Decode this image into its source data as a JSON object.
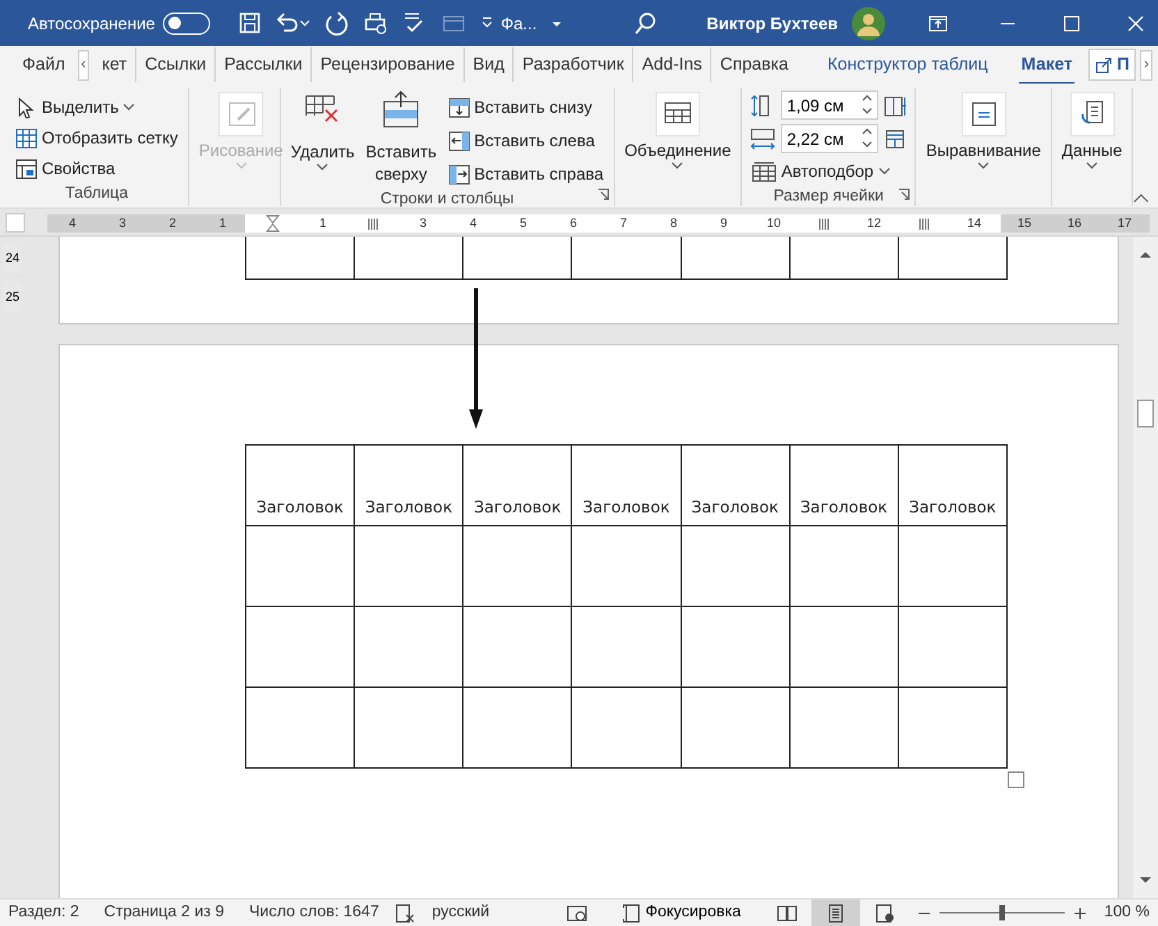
{
  "title_bar": {
    "autosave_label": "Автосохранение",
    "autosave_on": false,
    "file_name": "Фа...",
    "user_name": "Виктор Бухтеев"
  },
  "tabs": [
    {
      "label": "Файл",
      "selected": false,
      "kind": "tab"
    },
    {
      "label": "‹",
      "selected": false,
      "kind": "scroll"
    },
    {
      "label": "кет",
      "selected": false,
      "kind": "tab"
    },
    {
      "label": "Ссылки",
      "selected": false,
      "kind": "tab"
    },
    {
      "label": "Рассылки",
      "selected": false,
      "kind": "tab"
    },
    {
      "label": "Рецензирование",
      "selected": false,
      "kind": "tab"
    },
    {
      "label": "Вид",
      "selected": false,
      "kind": "tab"
    },
    {
      "label": "Разработчик",
      "selected": false,
      "kind": "tab"
    },
    {
      "label": "Add-Ins",
      "selected": false,
      "kind": "tab"
    },
    {
      "label": "Справка",
      "selected": false,
      "kind": "tab"
    },
    {
      "label": "Конструктор таблиц",
      "selected": false,
      "kind": "context"
    },
    {
      "label": "Макет",
      "selected": true,
      "kind": "context"
    }
  ],
  "share_button": {
    "label": "П"
  },
  "tab_scroll_right": "›",
  "ribbon": {
    "groups": [
      {
        "label": "Таблица",
        "items": [
          {
            "kind": "small",
            "label": "Выделить",
            "dropdown": true
          },
          {
            "kind": "small",
            "label": "Отобразить сетку"
          },
          {
            "kind": "small",
            "label": "Свойства"
          }
        ]
      },
      {
        "items": [
          {
            "kind": "large",
            "label": "Рисование",
            "dropdown": true,
            "disabled": true
          }
        ]
      },
      {
        "label": "Строки и столбцы",
        "items": [
          {
            "kind": "large",
            "label": "Удалить",
            "dropdown": true
          },
          {
            "kind": "large",
            "label": "Вставить сверху"
          },
          {
            "kind": "stack",
            "items": [
              {
                "label": "Вставить снизу"
              },
              {
                "label": "Вставить слева"
              },
              {
                "label": "Вставить справа"
              }
            ]
          }
        ],
        "launcher": true
      },
      {
        "items": [
          {
            "kind": "large",
            "label": "Объединение",
            "dropdown": true
          }
        ]
      },
      {
        "label": "Размер ячейки",
        "items": [
          {
            "kind": "size",
            "fields": [
              {
                "value": "1,09 см"
              },
              {
                "value": "2,22 см"
              }
            ],
            "autofit": "Автоподбор"
          }
        ],
        "launcher": true
      },
      {
        "items": [
          {
            "kind": "large",
            "label": "Выравнивание",
            "dropdown": true
          }
        ]
      },
      {
        "items": [
          {
            "kind": "large",
            "label": "Данные",
            "dropdown": true
          }
        ]
      }
    ]
  },
  "ruler": [
    {
      "kind": "number",
      "label": "4"
    },
    {
      "kind": "number",
      "label": "3"
    },
    {
      "kind": "number",
      "label": "2"
    },
    {
      "kind": "number",
      "label": "1"
    },
    {
      "kind": "indent"
    },
    {
      "kind": "number",
      "label": "1"
    },
    {
      "kind": "mark"
    },
    {
      "kind": "number",
      "label": "3"
    },
    {
      "kind": "number",
      "label": "4"
    },
    {
      "kind": "number",
      "label": "5"
    },
    {
      "kind": "number",
      "label": "6"
    },
    {
      "kind": "number",
      "label": "7"
    },
    {
      "kind": "number",
      "label": "8"
    },
    {
      "kind": "number",
      "label": "9"
    },
    {
      "kind": "number",
      "label": "10"
    },
    {
      "kind": "mark"
    },
    {
      "kind": "number",
      "label": "12"
    },
    {
      "kind": "mark"
    },
    {
      "kind": "number",
      "label": "14"
    },
    {
      "kind": "number",
      "label": "15"
    },
    {
      "kind": "number",
      "label": "16"
    },
    {
      "kind": "number",
      "label": "17"
    }
  ],
  "vertical_ruler": [
    "24",
    "25"
  ],
  "document": {
    "table": {
      "header": [
        "Заголовок",
        "Заголовок",
        "Заголовок",
        "Заголовок",
        "Заголовок",
        "Заголовок",
        "Заголовок"
      ]
    }
  },
  "status_bar": {
    "section": "Раздел: 2",
    "page": "Страница 2 из 9",
    "words": "Число слов: 1647",
    "language": "русский",
    "focus": "Фокусировка",
    "views": [
      {
        "kind": "read",
        "selected": false
      },
      {
        "kind": "print",
        "selected": true
      },
      {
        "kind": "web",
        "selected": false
      }
    ],
    "zoom_slider": {
      "level": 0.5
    },
    "zoom": "100 %"
  }
}
